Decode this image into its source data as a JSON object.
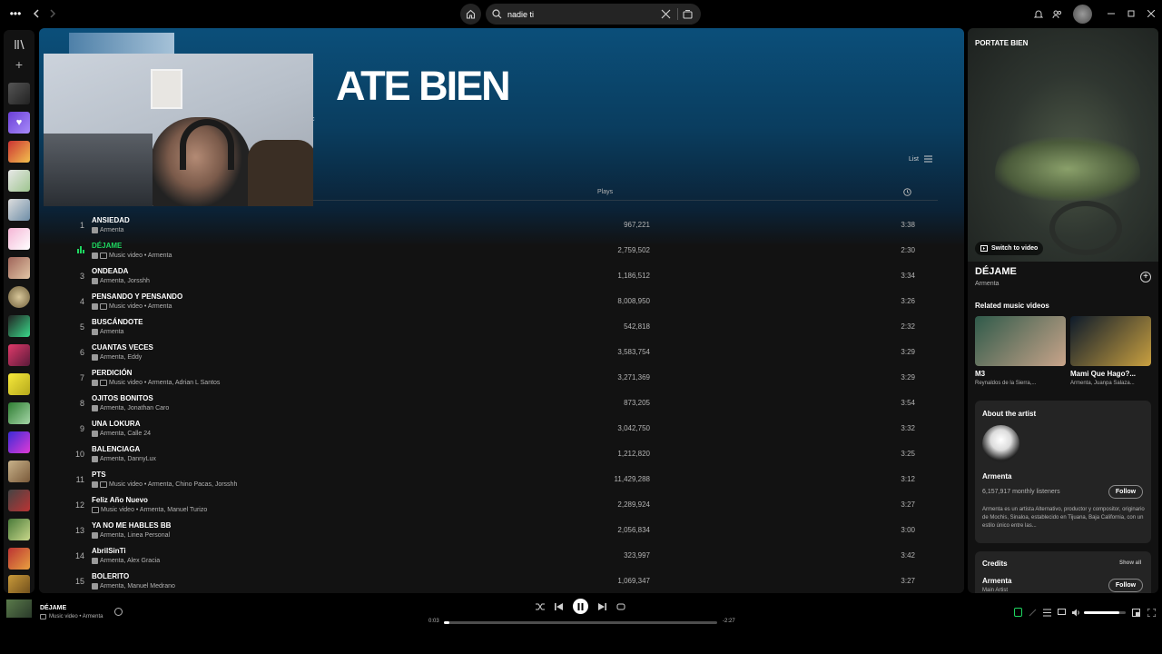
{
  "search": {
    "value": "nadie ti"
  },
  "header": {
    "title": "ATE BIEN",
    "title_sub": "c"
  },
  "list_view": {
    "label": "List",
    "plays_header": "Plays"
  },
  "tracks": [
    {
      "num": "1",
      "name": "ANSIEDAD",
      "sub": "Armenta",
      "plays": "967,221",
      "dur": "3:38",
      "video": false,
      "explicit": true
    },
    {
      "num": "",
      "name": "DÉJAME",
      "sub": "Music video • Armenta",
      "plays": "2,759,502",
      "dur": "2:30",
      "video": true,
      "explicit": true,
      "playing": true
    },
    {
      "num": "3",
      "name": "ONDEADA",
      "sub": "Armenta, Jorsshh",
      "plays": "1,186,512",
      "dur": "3:34",
      "video": false,
      "explicit": true
    },
    {
      "num": "4",
      "name": "PENSANDO Y PENSANDO",
      "sub": "Music video • Armenta",
      "plays": "8,008,950",
      "dur": "3:26",
      "video": true,
      "explicit": true
    },
    {
      "num": "5",
      "name": "BUSCÁNDOTE",
      "sub": "Armenta",
      "plays": "542,818",
      "dur": "2:32",
      "video": false,
      "explicit": true
    },
    {
      "num": "6",
      "name": "CUANTAS VECES",
      "sub": "Armenta, Eddy",
      "plays": "3,583,754",
      "dur": "3:29",
      "video": false,
      "explicit": true
    },
    {
      "num": "7",
      "name": "PERDICIÓN",
      "sub": "Music video • Armenta, Adrian L Santos",
      "plays": "3,271,369",
      "dur": "3:29",
      "video": true,
      "explicit": true
    },
    {
      "num": "8",
      "name": "OJITOS BONITOS",
      "sub": "Armenta, Jonathan Caro",
      "plays": "873,205",
      "dur": "3:54",
      "video": false,
      "explicit": true
    },
    {
      "num": "9",
      "name": "UNA LOKURA",
      "sub": "Armenta, Calle 24",
      "plays": "3,042,750",
      "dur": "3:32",
      "video": false,
      "explicit": true
    },
    {
      "num": "10",
      "name": "BALENCIAGA",
      "sub": "Armenta, DannyLux",
      "plays": "1,212,820",
      "dur": "3:25",
      "video": false,
      "explicit": true
    },
    {
      "num": "11",
      "name": "PTS",
      "sub": "Music video • Armenta, Chino Pacas, Jorsshh",
      "plays": "11,429,288",
      "dur": "3:12",
      "video": true,
      "explicit": true
    },
    {
      "num": "12",
      "name": "Feliz Año Nuevo",
      "sub": "Music video • Armenta, Manuel Turizo",
      "plays": "2,289,924",
      "dur": "3:27",
      "video": true,
      "explicit": false
    },
    {
      "num": "13",
      "name": "YA NO ME HABLES BB",
      "sub": "Armenta, Linea Personal",
      "plays": "2,056,834",
      "dur": "3:00",
      "video": false,
      "explicit": true
    },
    {
      "num": "14",
      "name": "AbrilSinTi",
      "sub": "Armenta, Alex Gracia",
      "plays": "323,997",
      "dur": "3:42",
      "video": false,
      "explicit": true
    },
    {
      "num": "15",
      "name": "BOLERITO",
      "sub": "Armenta, Manuel Medrano",
      "plays": "1,069,347",
      "dur": "3:27",
      "video": false,
      "explicit": true
    }
  ],
  "right_panel": {
    "header": "PORTATE BIEN",
    "switch_video": "Switch to video",
    "song_title": "DÉJAME",
    "song_artist": "Armenta",
    "related_title": "Related music videos",
    "related": [
      {
        "title": "M3",
        "sub": "Reynaldos de la Sierra,..."
      },
      {
        "title": "Mami Que Hago?...",
        "sub": "Armenta, Juanpa Salaza..."
      }
    ],
    "about_title": "About the artist",
    "artist_name": "Armenta",
    "listeners": "6,157,917 monthly listeners",
    "follow": "Follow",
    "bio": "Armenta es un artista Alternativo, productor y compositor, originario de Mochis, Sinaloa, establecido en Tijuana, Baja California, con un estilo único entre las...",
    "credits_title": "Credits",
    "show_all": "Show all",
    "credit_name": "Armenta",
    "credit_role": "Main Artist"
  },
  "player": {
    "title": "DÉJAME",
    "sub": "Music video • Armenta",
    "elapsed": "0:03",
    "remaining": "-2:27",
    "progress": 0.02,
    "volume": 0.85
  },
  "colors": {
    "accent": "#1ed760",
    "bg": "#121212",
    "hero": "#0b4f7a"
  }
}
